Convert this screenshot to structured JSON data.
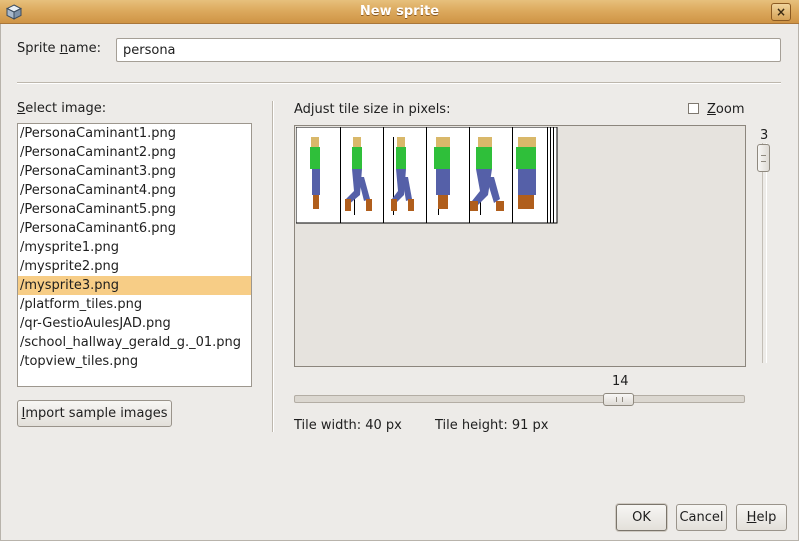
{
  "window": {
    "title": "New sprite",
    "close_label": "×"
  },
  "sprite_name": {
    "label_pre": "Sprite ",
    "label_ul": "n",
    "label_post": "ame:",
    "value": "persona"
  },
  "image_list": {
    "label_ul": "S",
    "label_post": "elect image:",
    "items": [
      "/PersonaCaminant1.png",
      "/PersonaCaminant2.png",
      "/PersonaCaminant3.png",
      "/PersonaCaminant4.png",
      "/PersonaCaminant5.png",
      "/PersonaCaminant6.png",
      "/mysprite1.png",
      "/mysprite2.png",
      "/mysprite3.png",
      "/platform_tiles.png",
      "/qr-GestioAulesJAD.png",
      "/school_hallway_gerald_g._01.png",
      "/topview_tiles.png"
    ],
    "selected": "/mysprite3.png",
    "import_label_ul": "I",
    "import_label_post": "mport sample images"
  },
  "tile_editor": {
    "title": "Adjust tile size in pixels:",
    "zoom_label_ul": "Z",
    "zoom_label_post": "oom",
    "zoom_checked": false,
    "vertical_slider_value": "3",
    "horizontal_slider_value": "14",
    "tile_width": "Tile width: 40 px",
    "tile_height": "Tile height: 91 px"
  },
  "colors": {
    "title_bar": "#d9a45a",
    "selection": "#f7cd86"
  },
  "buttons": {
    "ok": "OK",
    "cancel": "Cancel",
    "help_ul": "H",
    "help_post": "elp"
  }
}
